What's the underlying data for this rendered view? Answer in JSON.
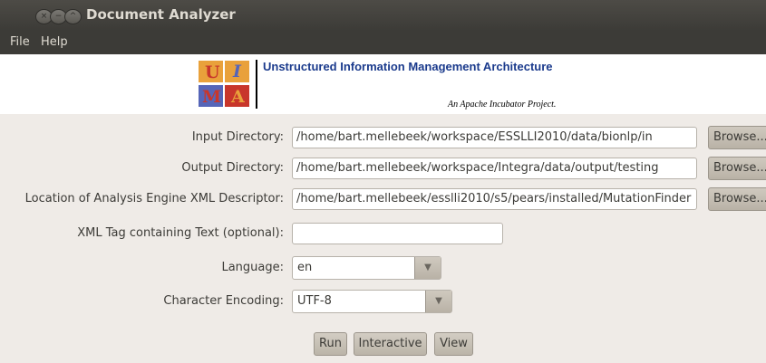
{
  "window": {
    "title": "Document Analyzer",
    "controls": {
      "close": "×",
      "minimize": "−",
      "maximize": "^"
    }
  },
  "menu": [
    "File",
    "Help"
  ],
  "banner": {
    "logo_letters": [
      "U",
      "I",
      "M",
      "A"
    ],
    "title": "Unstructured Information Management Architecture",
    "subtitle": "An Apache Incubator Project."
  },
  "form": {
    "input_dir": {
      "label": "Input Directory:",
      "value": "/home/bart.mellebeek/workspace/ESSLLI2010/data/bionlp/in",
      "browse": "Browse..."
    },
    "output_dir": {
      "label": "Output Directory:",
      "value": "/home/bart.mellebeek/workspace/Integra/data/output/testing",
      "browse": "Browse..."
    },
    "descriptor": {
      "label": "Location of Analysis Engine XML Descriptor:",
      "value": "/home/bart.mellebeek/esslli2010/s5/pears/installed/MutationFinder",
      "browse": "Browse..."
    },
    "xml_tag": {
      "label": "XML Tag containing Text (optional):",
      "value": ""
    },
    "language": {
      "label": "Language:",
      "value": "en"
    },
    "encoding": {
      "label": "Character Encoding:",
      "value": "UTF-8"
    }
  },
  "buttons": {
    "run": "Run",
    "interactive": "Interactive",
    "view": "View"
  },
  "colors": {
    "banner_title": "#1a3a8c",
    "logo_orange": "#e9a13b",
    "logo_blue": "#5565b8",
    "logo_red": "#c8362b"
  }
}
